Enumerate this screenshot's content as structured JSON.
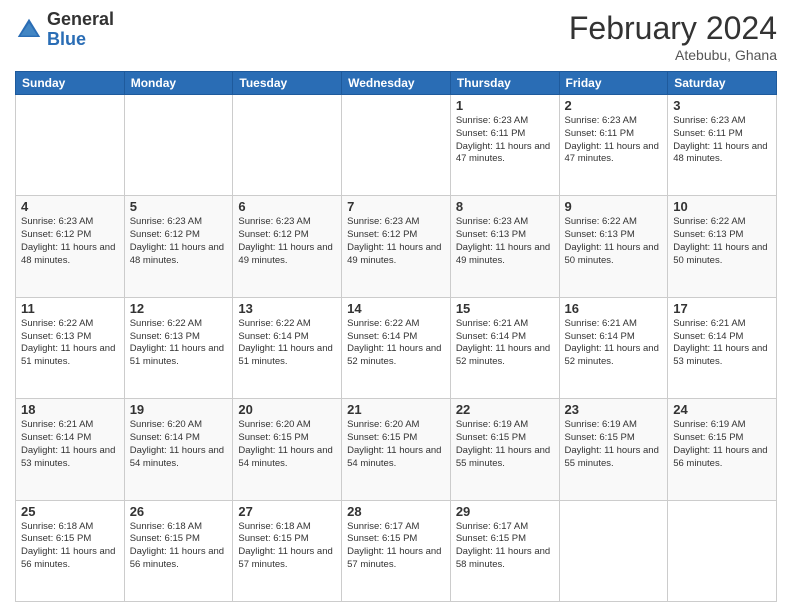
{
  "header": {
    "logo_general": "General",
    "logo_blue": "Blue",
    "month_title": "February 2024",
    "location": "Atebubu, Ghana"
  },
  "days_of_week": [
    "Sunday",
    "Monday",
    "Tuesday",
    "Wednesday",
    "Thursday",
    "Friday",
    "Saturday"
  ],
  "weeks": [
    [
      {
        "day": "",
        "info": ""
      },
      {
        "day": "",
        "info": ""
      },
      {
        "day": "",
        "info": ""
      },
      {
        "day": "",
        "info": ""
      },
      {
        "day": "1",
        "info": "Sunrise: 6:23 AM\nSunset: 6:11 PM\nDaylight: 11 hours and 47 minutes."
      },
      {
        "day": "2",
        "info": "Sunrise: 6:23 AM\nSunset: 6:11 PM\nDaylight: 11 hours and 47 minutes."
      },
      {
        "day": "3",
        "info": "Sunrise: 6:23 AM\nSunset: 6:11 PM\nDaylight: 11 hours and 48 minutes."
      }
    ],
    [
      {
        "day": "4",
        "info": "Sunrise: 6:23 AM\nSunset: 6:12 PM\nDaylight: 11 hours and 48 minutes."
      },
      {
        "day": "5",
        "info": "Sunrise: 6:23 AM\nSunset: 6:12 PM\nDaylight: 11 hours and 48 minutes."
      },
      {
        "day": "6",
        "info": "Sunrise: 6:23 AM\nSunset: 6:12 PM\nDaylight: 11 hours and 49 minutes."
      },
      {
        "day": "7",
        "info": "Sunrise: 6:23 AM\nSunset: 6:12 PM\nDaylight: 11 hours and 49 minutes."
      },
      {
        "day": "8",
        "info": "Sunrise: 6:23 AM\nSunset: 6:13 PM\nDaylight: 11 hours and 49 minutes."
      },
      {
        "day": "9",
        "info": "Sunrise: 6:22 AM\nSunset: 6:13 PM\nDaylight: 11 hours and 50 minutes."
      },
      {
        "day": "10",
        "info": "Sunrise: 6:22 AM\nSunset: 6:13 PM\nDaylight: 11 hours and 50 minutes."
      }
    ],
    [
      {
        "day": "11",
        "info": "Sunrise: 6:22 AM\nSunset: 6:13 PM\nDaylight: 11 hours and 51 minutes."
      },
      {
        "day": "12",
        "info": "Sunrise: 6:22 AM\nSunset: 6:13 PM\nDaylight: 11 hours and 51 minutes."
      },
      {
        "day": "13",
        "info": "Sunrise: 6:22 AM\nSunset: 6:14 PM\nDaylight: 11 hours and 51 minutes."
      },
      {
        "day": "14",
        "info": "Sunrise: 6:22 AM\nSunset: 6:14 PM\nDaylight: 11 hours and 52 minutes."
      },
      {
        "day": "15",
        "info": "Sunrise: 6:21 AM\nSunset: 6:14 PM\nDaylight: 11 hours and 52 minutes."
      },
      {
        "day": "16",
        "info": "Sunrise: 6:21 AM\nSunset: 6:14 PM\nDaylight: 11 hours and 52 minutes."
      },
      {
        "day": "17",
        "info": "Sunrise: 6:21 AM\nSunset: 6:14 PM\nDaylight: 11 hours and 53 minutes."
      }
    ],
    [
      {
        "day": "18",
        "info": "Sunrise: 6:21 AM\nSunset: 6:14 PM\nDaylight: 11 hours and 53 minutes."
      },
      {
        "day": "19",
        "info": "Sunrise: 6:20 AM\nSunset: 6:14 PM\nDaylight: 11 hours and 54 minutes."
      },
      {
        "day": "20",
        "info": "Sunrise: 6:20 AM\nSunset: 6:15 PM\nDaylight: 11 hours and 54 minutes."
      },
      {
        "day": "21",
        "info": "Sunrise: 6:20 AM\nSunset: 6:15 PM\nDaylight: 11 hours and 54 minutes."
      },
      {
        "day": "22",
        "info": "Sunrise: 6:19 AM\nSunset: 6:15 PM\nDaylight: 11 hours and 55 minutes."
      },
      {
        "day": "23",
        "info": "Sunrise: 6:19 AM\nSunset: 6:15 PM\nDaylight: 11 hours and 55 minutes."
      },
      {
        "day": "24",
        "info": "Sunrise: 6:19 AM\nSunset: 6:15 PM\nDaylight: 11 hours and 56 minutes."
      }
    ],
    [
      {
        "day": "25",
        "info": "Sunrise: 6:18 AM\nSunset: 6:15 PM\nDaylight: 11 hours and 56 minutes."
      },
      {
        "day": "26",
        "info": "Sunrise: 6:18 AM\nSunset: 6:15 PM\nDaylight: 11 hours and 56 minutes."
      },
      {
        "day": "27",
        "info": "Sunrise: 6:18 AM\nSunset: 6:15 PM\nDaylight: 11 hours and 57 minutes."
      },
      {
        "day": "28",
        "info": "Sunrise: 6:17 AM\nSunset: 6:15 PM\nDaylight: 11 hours and 57 minutes."
      },
      {
        "day": "29",
        "info": "Sunrise: 6:17 AM\nSunset: 6:15 PM\nDaylight: 11 hours and 58 minutes."
      },
      {
        "day": "",
        "info": ""
      },
      {
        "day": "",
        "info": ""
      }
    ]
  ]
}
